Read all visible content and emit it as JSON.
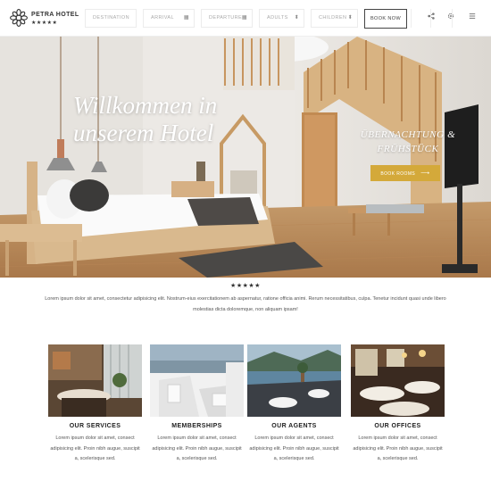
{
  "header": {
    "logo_name": "PETRA HOTEL",
    "logo_stars": "★★★★★",
    "fields": [
      {
        "label": "DESTINATION",
        "icon": ""
      },
      {
        "label": "ARRIVAL",
        "icon": "▦"
      },
      {
        "label": "DEPARTURE",
        "icon": "▦"
      },
      {
        "label": "ADULTS",
        "icon": "⬍"
      },
      {
        "label": "CHILDREN",
        "icon": "⬍"
      }
    ],
    "book_now": "BOOK NOW",
    "share_icon": "share-icon",
    "settings_icon": "gear-icon",
    "menu_icon": "menu-icon"
  },
  "hero": {
    "title_line1": "Willkommen in",
    "title_line2": "unserem Hotel",
    "subtitle_line1": "ÜBERNACHTUNG &",
    "subtitle_line2": "FRÜHSTÜCK",
    "book_rooms": "BOOK ROOMS",
    "book_rooms_arrow": "⟶"
  },
  "intro": {
    "stars": "★★★★★",
    "text": "Lorem ipsum dolor sit amet, consectetur adipisicing elit. Nostrum-eius exercitationem ab aspernatur, ratione officia animi. Rerum necessitatibus, culpa. Tenetur incidunt quasi unde libero molestias dicta doloremque, non aliquam ipsam!"
  },
  "services": [
    {
      "title": "OUR SERVICES",
      "text": "Lorem ipsum dolor sit amet, consect adipisicing elit. Proin nibh augue, suscipit a, scelerisque sed."
    },
    {
      "title": "MEMBERSHIPS",
      "text": "Lorem ipsum dolor sit amet, consect adipisicing elit. Proin nibh augue, suscipit a, scelerisque sed."
    },
    {
      "title": "OUR AGENTS",
      "text": "Lorem ipsum dolor sit amet, consect adipisicing elit. Proin nibh augue, suscipit a, scelerisque sed."
    },
    {
      "title": "OUR OFFICES",
      "text": "Lorem ipsum dolor sit amet, consect adipisicing elit. Proin nibh augue, suscipit a, scelerisque sed."
    }
  ],
  "colors": {
    "accent": "#d4a93a",
    "text": "#555555",
    "heading": "#222222"
  }
}
